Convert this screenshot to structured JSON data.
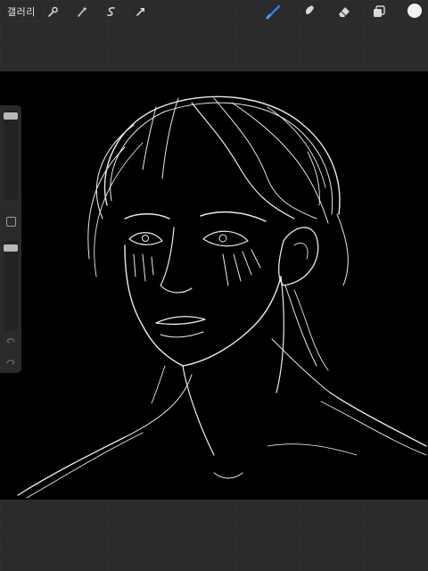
{
  "toolbar": {
    "gallery_label": "갤러리",
    "left_tools": [
      "wrench-icon",
      "magic-wand-icon",
      "selection-icon",
      "transform-arrow-icon"
    ],
    "right_tools": [
      "brush-icon",
      "smudge-icon",
      "eraser-icon",
      "layers-icon"
    ],
    "active_tool": "brush",
    "active_color": "#f2f2f2",
    "accent": "#3a7bf5"
  },
  "sidebar": {
    "controls": [
      "brush-size-slider",
      "modify-button",
      "opacity-slider",
      "undo-icon",
      "redo-icon"
    ]
  },
  "canvas": {
    "background": "#000000",
    "stroke_color": "#ffffff"
  }
}
